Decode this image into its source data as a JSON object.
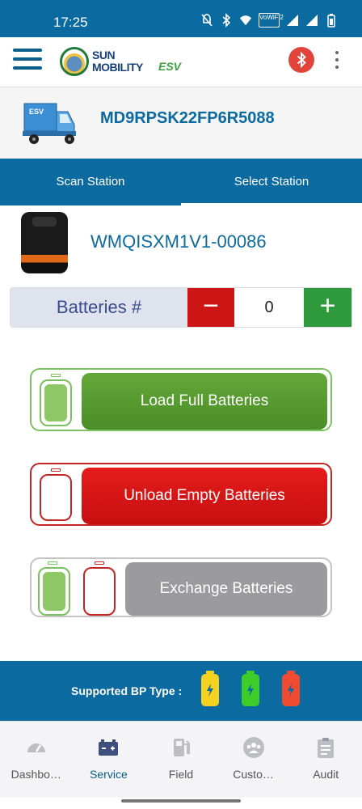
{
  "status_bar": {
    "time": "17:25",
    "icons": [
      "mute-icon",
      "bluetooth-icon",
      "wifi-icon",
      "vowifi-icon",
      "signal-icon",
      "signal-icon",
      "battery-icon"
    ],
    "vowifi_text": "VoWiFi2"
  },
  "header": {
    "logo_line1": "SUN",
    "logo_line2": "MOBILITY",
    "logo_suffix": "ESV",
    "bluetooth_icon": "bluetooth-icon",
    "colors": {
      "primary": "#0b6aa0",
      "bluetooth": "#e0443a"
    }
  },
  "vehicle": {
    "icon_label": "ESV",
    "id": "MD9RPSK22FP6R5088"
  },
  "tabs": [
    {
      "label": "Scan Station"
    },
    {
      "label": "Select Station"
    }
  ],
  "station": {
    "id": "WMQISXM1V1-00086"
  },
  "batteries": {
    "label": "Batteries #",
    "value": "0",
    "minus": "−",
    "plus": "+"
  },
  "actions": {
    "load": "Load Full Batteries",
    "unload": "Unload Empty Batteries",
    "exchange": "Exchange Batteries",
    "colors": {
      "load": "#4a8d26",
      "unload": "#c70f0f",
      "exchange": "#9b9b9e"
    }
  },
  "supported": {
    "label": "Supported BP Type :",
    "types": [
      {
        "color": "#f5d21f",
        "icon": "lightning-icon"
      },
      {
        "color": "#3ccd29",
        "icon": "lightning-icon"
      },
      {
        "color": "#f04a30",
        "icon": "lightning-icon"
      }
    ]
  },
  "nav": [
    {
      "label": "Dashbo…",
      "icon": "dashboard-icon"
    },
    {
      "label": "Service",
      "icon": "battery-service-icon",
      "active": true
    },
    {
      "label": "Field",
      "icon": "fuel-pump-icon"
    },
    {
      "label": "Custo…",
      "icon": "customers-icon"
    },
    {
      "label": "Audit",
      "icon": "clipboard-icon"
    }
  ]
}
